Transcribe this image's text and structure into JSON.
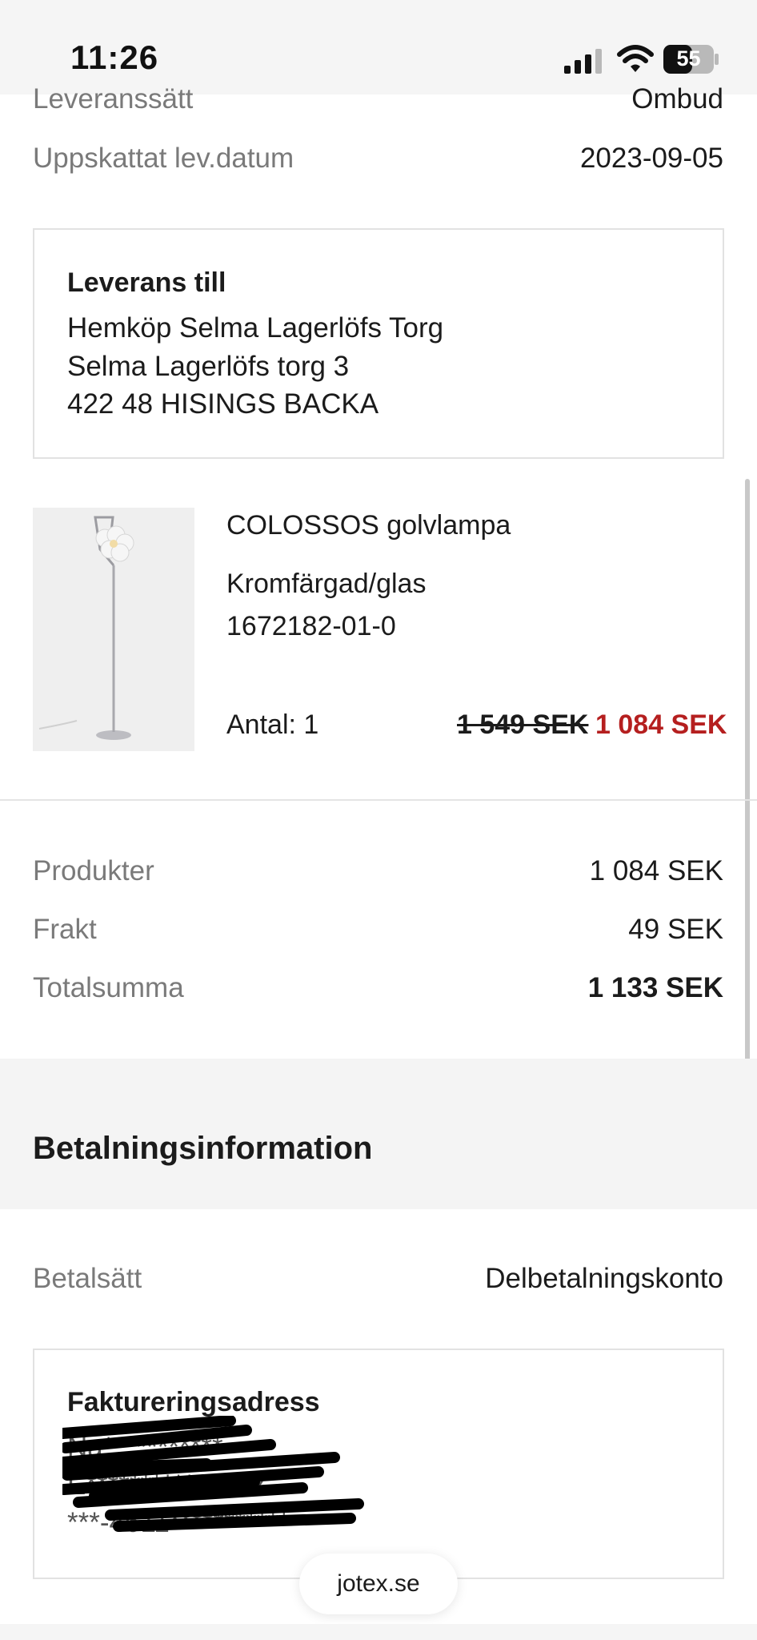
{
  "status_bar": {
    "time": "11:26",
    "battery": "55"
  },
  "shipping_rows": [
    {
      "label": "Leveranssätt",
      "value": "Ombud"
    },
    {
      "label": "Uppskattat lev.datum",
      "value": "2023-09-05"
    }
  ],
  "delivery": {
    "title": "Leverans till",
    "lines": [
      "Hemköp Selma Lagerlöfs Torg",
      "Selma Lagerlöfs torg 3",
      "422 48 HISINGS BACKA"
    ]
  },
  "product": {
    "name": "COLOSSOS golvlampa",
    "variant": "Kromfärgad/glas",
    "sku": "1672182-01-0",
    "quantity": "Antal: 1",
    "old_price": "1 549 SEK",
    "new_price": "1 084 SEK",
    "image_icon": "floor-lamp-image"
  },
  "summary": [
    {
      "label": "Produkter",
      "value": "1 084 SEK"
    },
    {
      "label": "Frakt",
      "value": "49 SEK"
    },
    {
      "label": "Totalsumma",
      "value": "1 133 SEK"
    }
  ],
  "payment": {
    "section_title": "Betalningsinformation",
    "method_label": "Betalsätt",
    "method_value": "Delbetalningskonto"
  },
  "billing": {
    "title": "Faktureringsadress",
    "lines": [
      "Na***********",
      "E***************2",
      "***-4611***********"
    ]
  },
  "browser": {
    "url": "jotex.se"
  },
  "colors": {
    "sale_red": "#b51f1f",
    "label_gray": "#7a7a7a",
    "band_gray": "#f4f4f4"
  }
}
